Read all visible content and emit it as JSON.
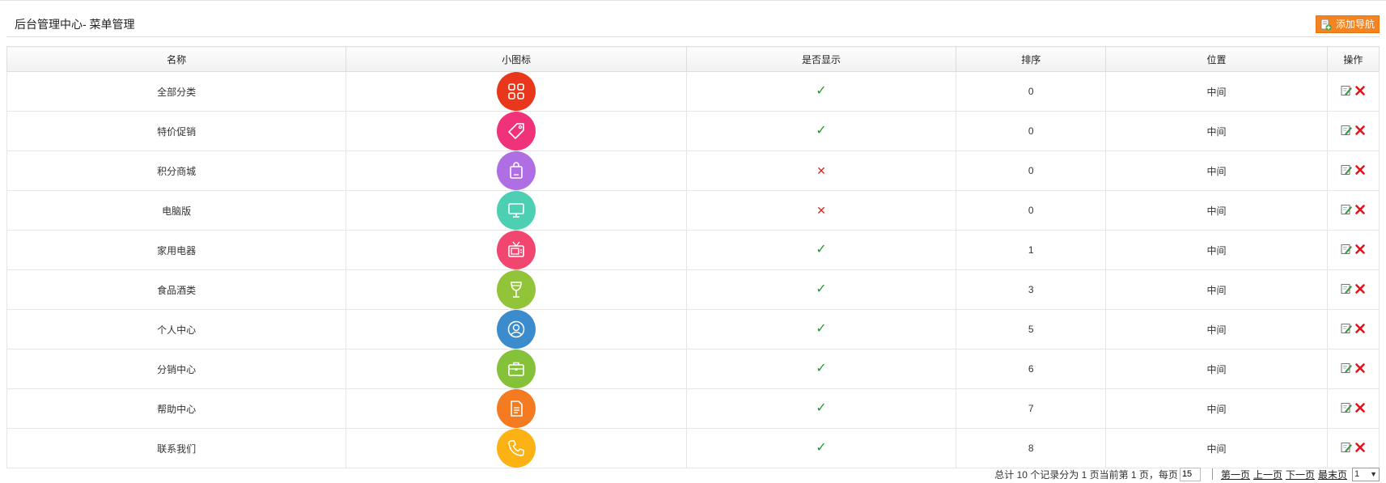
{
  "header": {
    "title": "后台管理中心- 菜单管理",
    "add_button_label": "添加导航"
  },
  "table": {
    "columns": [
      "名称",
      "小图标",
      "是否显示",
      "排序",
      "位置",
      "操作"
    ],
    "rows": [
      {
        "name": "全部分类",
        "icon": "grid-icon",
        "color": "#e8371b",
        "shown": true,
        "sort": "0",
        "position": "中间"
      },
      {
        "name": "特价促销",
        "icon": "tag-icon",
        "color": "#f0327a",
        "shown": true,
        "sort": "0",
        "position": "中间"
      },
      {
        "name": "积分商城",
        "icon": "shopping-bag-icon",
        "color": "#b06ee5",
        "shown": false,
        "sort": "0",
        "position": "中间"
      },
      {
        "name": "电脑版",
        "icon": "monitor-icon",
        "color": "#4ccfb2",
        "shown": false,
        "sort": "0",
        "position": "中间"
      },
      {
        "name": "家用电器",
        "icon": "tv-icon",
        "color": "#f0466f",
        "shown": true,
        "sort": "1",
        "position": "中间"
      },
      {
        "name": "食品酒类",
        "icon": "wine-glass-icon",
        "color": "#92c43a",
        "shown": true,
        "sort": "3",
        "position": "中间"
      },
      {
        "name": "个人中心",
        "icon": "user-icon",
        "color": "#3c8ccd",
        "shown": true,
        "sort": "5",
        "position": "中间"
      },
      {
        "name": "分销中心",
        "icon": "briefcase-icon",
        "color": "#86c13a",
        "shown": true,
        "sort": "6",
        "position": "中间"
      },
      {
        "name": "帮助中心",
        "icon": "document-icon",
        "color": "#f47b1f",
        "shown": true,
        "sort": "7",
        "position": "中间"
      },
      {
        "name": "联系我们",
        "icon": "phone-icon",
        "color": "#fbb212",
        "shown": true,
        "sort": "8",
        "position": "中间"
      }
    ],
    "check_symbol": "✓",
    "cross_symbol": "✕"
  },
  "pager": {
    "summary": "总计 10 个记录分为 1 页当前第 1 页，每页",
    "per_page": "15",
    "first": "第一页",
    "prev": "上一页",
    "next": "下一页",
    "last": "最末页",
    "current_page": "1"
  }
}
